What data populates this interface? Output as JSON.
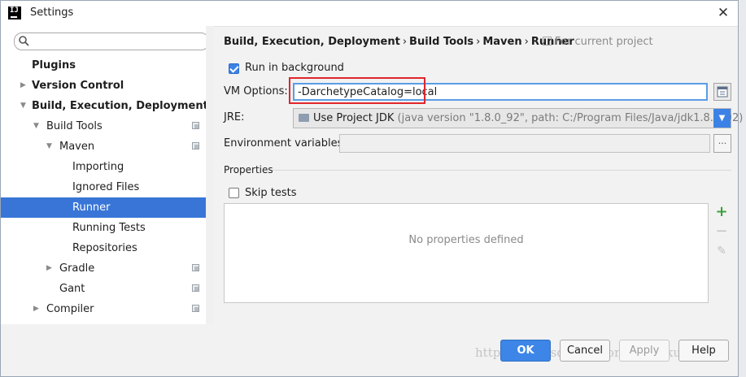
{
  "window": {
    "title": "Settings"
  },
  "sidebar": {
    "search": {
      "placeholder": "",
      "value": ""
    },
    "items": [
      {
        "label": "Plugins",
        "level": 0,
        "bold": true,
        "arrow": "",
        "has_icon": false,
        "selected": false
      },
      {
        "label": "Version Control",
        "level": 0,
        "bold": true,
        "arrow": "▶",
        "has_icon": false,
        "selected": false
      },
      {
        "label": "Build, Execution, Deployment",
        "level": 0,
        "bold": true,
        "arrow": "▼",
        "has_icon": false,
        "selected": false
      },
      {
        "label": "Build Tools",
        "level": 1,
        "bold": false,
        "arrow": "▼",
        "has_icon": true,
        "selected": false
      },
      {
        "label": "Maven",
        "level": 2,
        "bold": false,
        "arrow": "▼",
        "has_icon": true,
        "selected": false
      },
      {
        "label": "Importing",
        "level": 3,
        "bold": false,
        "arrow": "",
        "has_icon": false,
        "selected": false
      },
      {
        "label": "Ignored Files",
        "level": 3,
        "bold": false,
        "arrow": "",
        "has_icon": false,
        "selected": false
      },
      {
        "label": "Runner",
        "level": 3,
        "bold": false,
        "arrow": "",
        "has_icon": false,
        "selected": true
      },
      {
        "label": "Running Tests",
        "level": 3,
        "bold": false,
        "arrow": "",
        "has_icon": false,
        "selected": false
      },
      {
        "label": "Repositories",
        "level": 3,
        "bold": false,
        "arrow": "",
        "has_icon": false,
        "selected": false
      },
      {
        "label": "Gradle",
        "level": 2,
        "bold": false,
        "arrow": "▶",
        "has_icon": true,
        "selected": false
      },
      {
        "label": "Gant",
        "level": 2,
        "bold": false,
        "arrow": "",
        "has_icon": true,
        "selected": false
      },
      {
        "label": "Compiler",
        "level": 1,
        "bold": false,
        "arrow": "▶",
        "has_icon": true,
        "selected": false
      }
    ]
  },
  "main": {
    "breadcrumb": [
      "Build, Execution, Deployment",
      "Build Tools",
      "Maven",
      "Runner"
    ],
    "breadcrumb_sep": "›",
    "scope": "For current project",
    "run_in_background": {
      "label": "Run in background",
      "checked": true
    },
    "vm_options": {
      "label": "VM Options:",
      "value": "-DarchetypeCatalog=local"
    },
    "jre": {
      "label": "JRE:",
      "value": "Use Project JDK",
      "detail": "(java version \"1.8.0_92\", path: C:/Program Files/Java/jdk1.8.0_92)"
    },
    "env": {
      "label": "Environment variables:",
      "value": "",
      "button": "..."
    },
    "properties": {
      "title": "Properties",
      "skip_tests": {
        "label": "Skip tests",
        "checked": false
      },
      "empty_text": "No properties defined"
    }
  },
  "footer": {
    "ok": "OK",
    "cancel": "Cancel",
    "apply": "Apply",
    "help": "Help"
  },
  "watermark": "http://blog.csdn.net/zongf1hunkui",
  "colors": {
    "accent": "#3875d7",
    "highlight": "#e0262d",
    "add": "#3aa03a"
  }
}
